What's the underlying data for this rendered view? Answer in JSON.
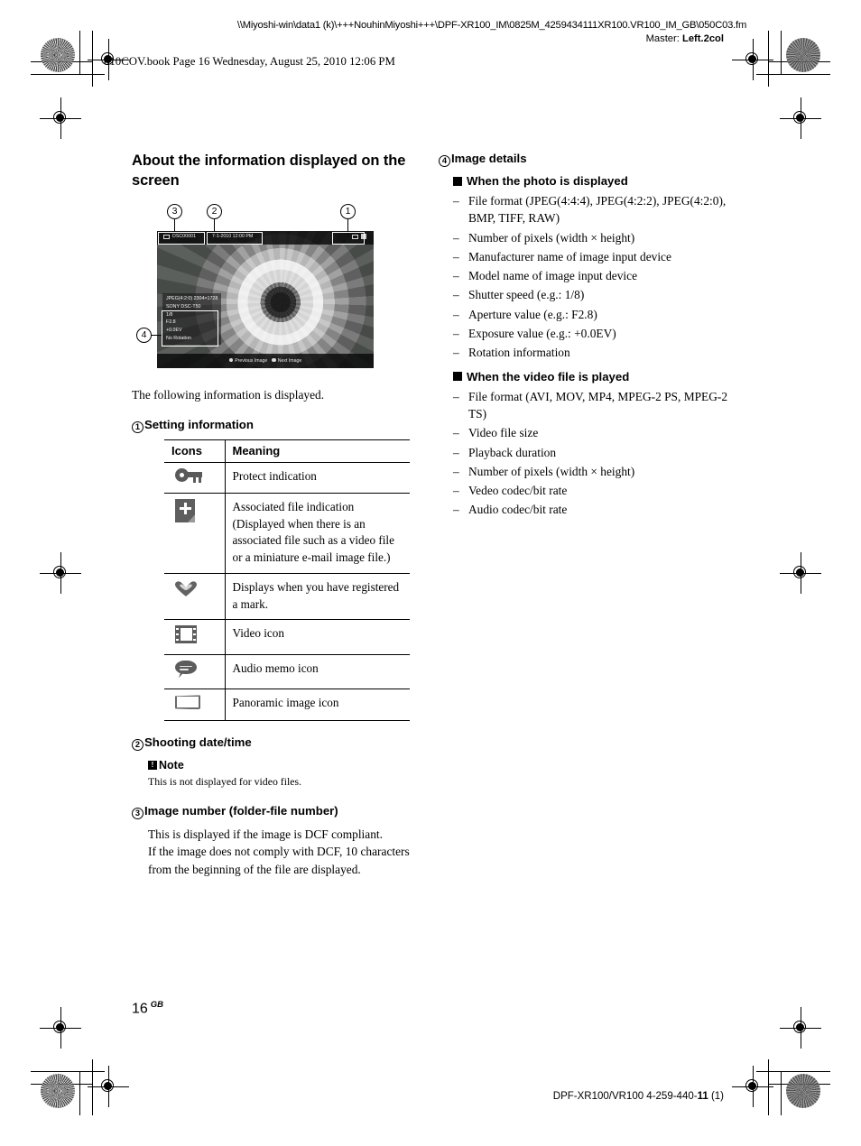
{
  "header": {
    "file_path": "\\\\Miyoshi-win\\data1 (k)\\+++NouhinMiyoshi+++\\DPF-XR100_IM\\0825M_4259434111XR100.VR100_IM_GB\\050C03.fm",
    "master_label": "Master:",
    "master_value": "Left.2col",
    "book_line": "010COV.book  Page 16  Wednesday, August 25, 2010  12:06 PM"
  },
  "left_column": {
    "section_title": "About the information displayed on the screen",
    "figure": {
      "callouts": [
        "3",
        "2",
        "1",
        "4"
      ],
      "screen": {
        "image_number": "DSC00001",
        "date_time": "7-1-2010  12:00 PM",
        "details": [
          "JPEG(4:2:0)  2304×1728",
          "SONY   DSC-T50",
          "1/8",
          "F2.8",
          "+0.0EV",
          "No Rotation"
        ],
        "bottom_hints": [
          "Previous Image",
          "Next Image"
        ]
      }
    },
    "intro": "The following information is displayed.",
    "setting_information": {
      "number": "1",
      "heading": "Setting information",
      "table": {
        "headers": [
          "Icons",
          "Meaning"
        ],
        "rows": [
          {
            "icon": "key-icon",
            "meaning": "Protect indication"
          },
          {
            "icon": "associated-file-icon",
            "meaning": "Associated file indication (Displayed when there is an associated file such as a video file or a miniature e-mail image file.)"
          },
          {
            "icon": "heart-mark-icon",
            "meaning": "Displays when you have registered a mark."
          },
          {
            "icon": "video-icon",
            "meaning": "Video icon"
          },
          {
            "icon": "audio-memo-icon",
            "meaning": "Audio memo icon"
          },
          {
            "icon": "panoramic-image-icon",
            "meaning": "Panoramic image icon"
          }
        ]
      }
    },
    "shooting_date": {
      "number": "2",
      "heading": "Shooting date/time",
      "note_label": "Note",
      "note_text": "This is not displayed for video files."
    },
    "image_number": {
      "number": "3",
      "heading": "Image number (folder-file number)",
      "paragraphs": [
        "This is displayed if the image is DCF compliant.",
        "If the image does not comply with DCF, 10 characters from the beginning of the file are displayed."
      ]
    }
  },
  "right_column": {
    "image_details": {
      "number": "4",
      "heading": "Image details",
      "photo_section": {
        "heading": "When the photo is displayed",
        "items": [
          "File format (JPEG(4:4:4), JPEG(4:2:2), JPEG(4:2:0), BMP, TIFF, RAW)",
          "Number of pixels (width × height)",
          "Manufacturer name of image input device",
          "Model name of image input device",
          "Shutter speed (e.g.: 1/8)",
          "Aperture value (e.g.: F2.8)",
          "Exposure value (e.g.: +0.0EV)",
          "Rotation information"
        ]
      },
      "video_section": {
        "heading": "When the video file is played",
        "items": [
          "File format (AVI, MOV, MP4, MPEG-2 PS, MPEG-2 TS)",
          "Video file size",
          "Playback duration",
          "Number of pixels (width × height)",
          "Vedeo codec/bit rate",
          "Audio codec/bit rate"
        ]
      }
    }
  },
  "footer": {
    "page_number": "16",
    "page_suffix": "GB",
    "model_line_prefix": "DPF-XR100/VR100 4-259-440-",
    "model_line_bold": "11",
    "model_line_suffix": " (1)"
  }
}
